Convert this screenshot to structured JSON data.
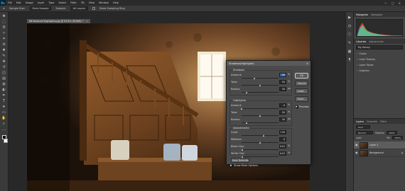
{
  "app": {
    "logo": "Ps",
    "menus": [
      "File",
      "Edit",
      "Image",
      "Layer",
      "Type",
      "Select",
      "Filter",
      "3D",
      "View",
      "Window",
      "Help"
    ],
    "window_controls": [
      "—",
      "□",
      "✕"
    ]
  },
  "options_bar": {
    "tool_preset": "Sample Size:",
    "sample_value": "Point Sample",
    "sample_label": "Sample:",
    "sample_layers": "All Layers",
    "show_ring_label": "Show Sampling Ring"
  },
  "toolbar": {
    "tools": [
      "move-icon",
      "marquee-icon",
      "lasso-icon",
      "quick-select-icon",
      "crop-icon",
      "eyedropper-icon",
      "healing-icon",
      "brush-icon",
      "stamp-icon",
      "history-brush-icon",
      "eraser-icon",
      "gradient-icon",
      "blur-icon",
      "dodge-icon",
      "pen-icon",
      "type-icon",
      "path-select-icon",
      "shape-icon",
      "hand-icon",
      "zoom-icon",
      "more-icon"
    ]
  },
  "document": {
    "tab_title": "86 Restored Highlights.jpg @ 93.8% (RGB/8) *",
    "close_glyph": "×"
  },
  "dialog": {
    "title": "Shadows/Highlights",
    "close_glyph": "✕",
    "shadows": {
      "label": "Shadows",
      "rows": [
        {
          "label": "Amount:",
          "value": "35",
          "unit": "%",
          "knob_fraction": 0.35,
          "selected": true
        },
        {
          "label": "Tone:",
          "value": "50",
          "unit": "%",
          "knob_fraction": 0.5
        },
        {
          "label": "Radius:",
          "value": "30",
          "unit": "px",
          "knob_fraction": 0.15
        }
      ]
    },
    "highlights": {
      "label": "Highlights",
      "rows": [
        {
          "label": "Amount:",
          "value": "0",
          "unit": "%",
          "knob_fraction": 0.0
        },
        {
          "label": "Tone:",
          "value": "50",
          "unit": "%",
          "knob_fraction": 0.5
        },
        {
          "label": "Radius:",
          "value": "30",
          "unit": "px",
          "knob_fraction": 0.15
        }
      ]
    },
    "adjustments": {
      "label": "Adjustments",
      "rows": [
        {
          "label": "Color:",
          "value": "+20",
          "unit": "",
          "knob_fraction": 0.6
        },
        {
          "label": "Midtone:",
          "value": "0",
          "unit": "",
          "knob_fraction": 0.5
        },
        {
          "label": "Black Clip:",
          "value": "0.01",
          "unit": "%",
          "knob_fraction": 0.02
        },
        {
          "label": "White Clip:",
          "value": "0.01",
          "unit": "%",
          "knob_fraction": 0.02
        }
      ]
    },
    "buttons": {
      "ok": "OK",
      "cancel": "Cancel",
      "load": "Load...",
      "save": "Save..."
    },
    "preview_label": "Preview",
    "save_defaults": "Save Defaults",
    "more_options": "Show More Options"
  },
  "panels": {
    "tabs_top": [
      "Histogram",
      "Navigator"
    ],
    "tabs_mid": [
      "Libraries",
      "Adjustments"
    ],
    "library_select": "My Library",
    "library_items": [
      "Colors",
      "Color Themes",
      "Layer Styles",
      "Graphics"
    ],
    "layers_tabs": [
      "Layers",
      "Channels",
      "Paths"
    ],
    "kind_label": "Kind",
    "blend_mode": "Normal",
    "opacity_label": "Opacity:",
    "opacity_value": "100%",
    "lock_label": "Lock:",
    "fill_label": "Fill:",
    "fill_value": "100%",
    "layers": [
      {
        "name": "Layer 1",
        "active": true
      },
      {
        "name": "Background",
        "active": false
      }
    ]
  }
}
